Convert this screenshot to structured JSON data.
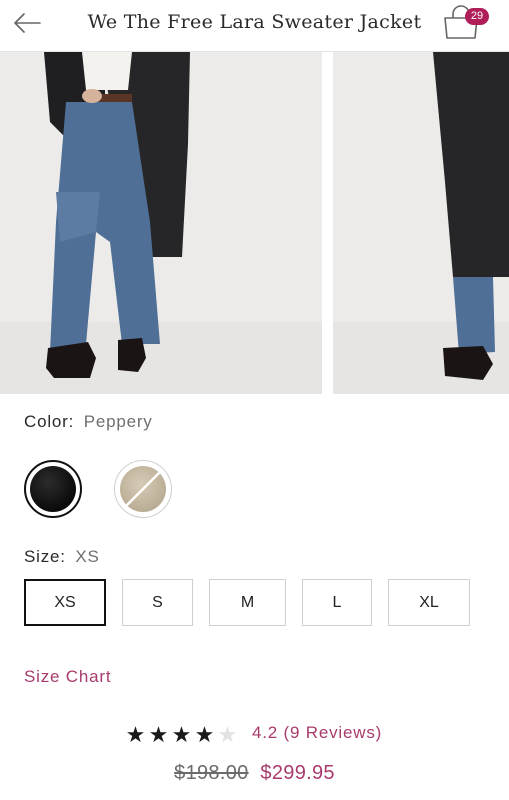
{
  "header": {
    "title": "We The Free Lara Sweater Jacket",
    "bag_count": "29",
    "back_icon": "arrow-left-icon",
    "bag_icon": "shopping-bag-icon"
  },
  "gallery": {
    "images": [
      {
        "alt": "product-photo-front"
      },
      {
        "alt": "product-photo-side"
      }
    ]
  },
  "color": {
    "label": "Color:",
    "value": "Peppery",
    "swatches": [
      {
        "name": "Peppery",
        "hex": "#141414",
        "selected": true
      },
      {
        "name": "Oatmeal",
        "hex": "#c9bda6",
        "selected": false,
        "unavailable": true
      }
    ]
  },
  "size": {
    "label": "Size:",
    "value": "XS",
    "options": [
      "XS",
      "S",
      "M",
      "L",
      "XL"
    ],
    "selected": "XS"
  },
  "size_chart_label": "Size Chart",
  "rating": {
    "value": 4.2,
    "stars_max": 5,
    "text": "4.2 (9 Reviews)"
  },
  "price": {
    "original": "$198.00",
    "current": "$299.95"
  },
  "colors": {
    "accent": "#a83b6e",
    "badge": "#b01e5a",
    "text": "#222222"
  }
}
